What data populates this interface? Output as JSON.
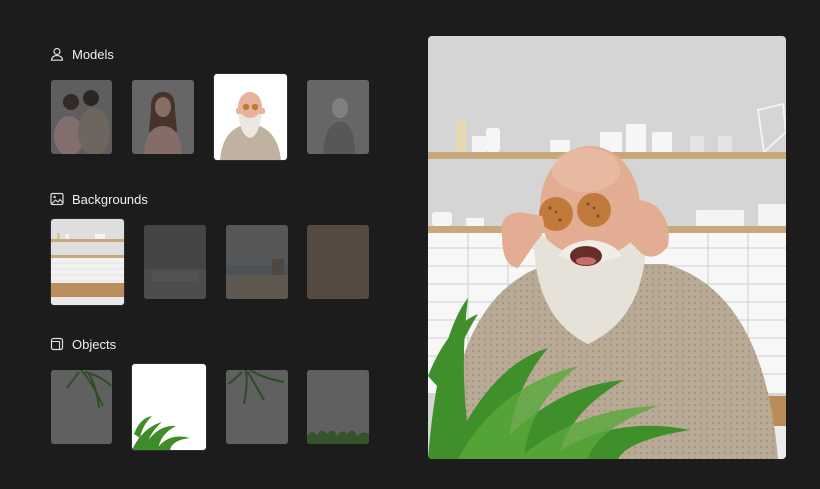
{
  "sections": {
    "models": {
      "title": "Models",
      "icon": "user-icon"
    },
    "backgrounds": {
      "title": "Backgrounds",
      "icon": "image-icon"
    },
    "objects": {
      "title": "Objects",
      "icon": "cube-icon"
    }
  },
  "selected": {
    "model": "old-man-with-cookies",
    "background": "kitchen",
    "object": "fern-plant"
  },
  "colors": {
    "background": "#1c1c1d",
    "text": "#f0f0f0",
    "thumbnail_dim": "#4a4a4c"
  }
}
